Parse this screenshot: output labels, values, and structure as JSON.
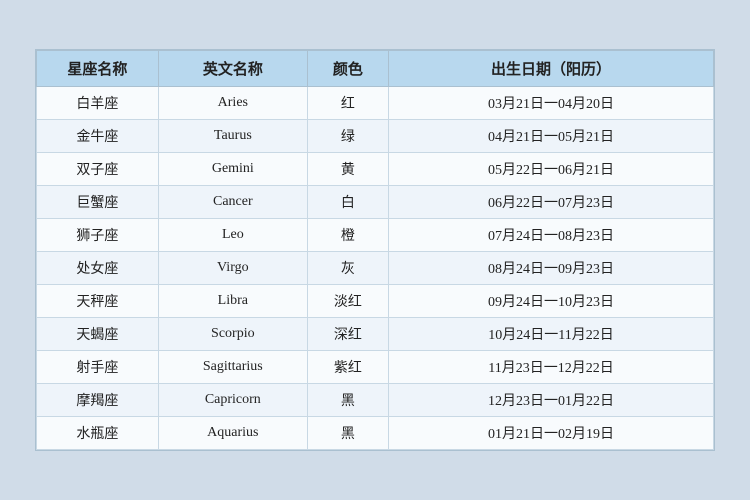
{
  "table": {
    "headers": [
      "星座名称",
      "英文名称",
      "颜色",
      "出生日期（阳历）"
    ],
    "rows": [
      {
        "cn": "白羊座",
        "en": "Aries",
        "color": "红",
        "date": "03月21日一04月20日"
      },
      {
        "cn": "金牛座",
        "en": "Taurus",
        "color": "绿",
        "date": "04月21日一05月21日"
      },
      {
        "cn": "双子座",
        "en": "Gemini",
        "color": "黄",
        "date": "05月22日一06月21日"
      },
      {
        "cn": "巨蟹座",
        "en": "Cancer",
        "color": "白",
        "date": "06月22日一07月23日"
      },
      {
        "cn": "狮子座",
        "en": "Leo",
        "color": "橙",
        "date": "07月24日一08月23日"
      },
      {
        "cn": "处女座",
        "en": "Virgo",
        "color": "灰",
        "date": "08月24日一09月23日"
      },
      {
        "cn": "天秤座",
        "en": "Libra",
        "color": "淡红",
        "date": "09月24日一10月23日"
      },
      {
        "cn": "天蝎座",
        "en": "Scorpio",
        "color": "深红",
        "date": "10月24日一11月22日"
      },
      {
        "cn": "射手座",
        "en": "Sagittarius",
        "color": "紫红",
        "date": "11月23日一12月22日"
      },
      {
        "cn": "摩羯座",
        "en": "Capricorn",
        "color": "黑",
        "date": "12月23日一01月22日"
      },
      {
        "cn": "水瓶座",
        "en": "Aquarius",
        "color": "黑",
        "date": "01月21日一02月19日"
      }
    ]
  }
}
